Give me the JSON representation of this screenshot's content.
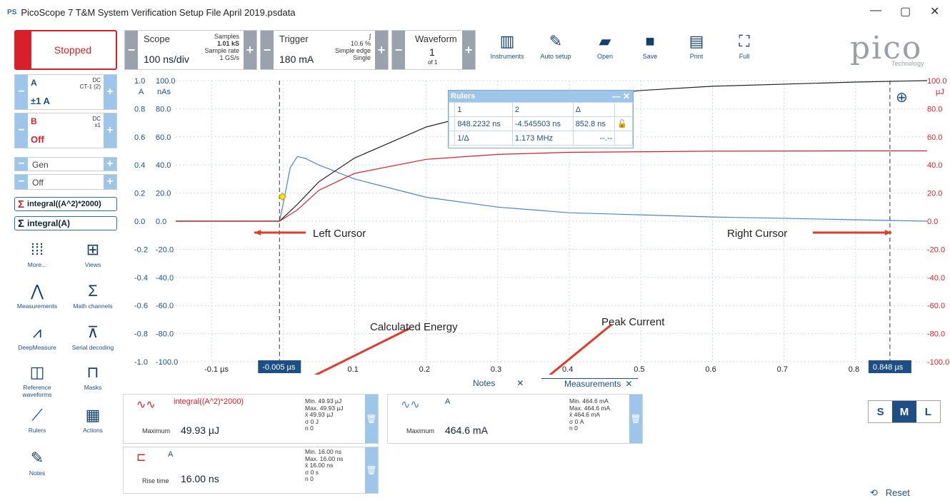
{
  "window": {
    "app_icon": "PS",
    "title": "PicoScope 7 T&M System Verification Setup File April 2019.psdata",
    "controls": [
      "—",
      "▢",
      "✕"
    ]
  },
  "toolbar": {
    "run_state": "Stopped",
    "scope": {
      "header": "Scope",
      "value": "100 ns/div",
      "samples_label": "Samples",
      "samples": "1.01 kS",
      "rate_label": "Sample rate",
      "rate": "1 GS/s"
    },
    "trigger": {
      "header": "Trigger",
      "value": "180 mA",
      "pct": "10.6 %",
      "type": "Simple edge",
      "mode": "Single"
    },
    "waveform": {
      "header": "Waveform",
      "value": "1",
      "of": "of 1"
    },
    "buttons": [
      {
        "label": "Instruments",
        "icon": "instruments-icon"
      },
      {
        "label": "Auto setup",
        "icon": "auto-setup-icon"
      },
      {
        "label": "Open",
        "icon": "folder-open-icon"
      },
      {
        "label": "Save",
        "icon": "save-icon"
      },
      {
        "label": "Print",
        "icon": "print-icon"
      },
      {
        "label": "Full",
        "icon": "fullscreen-icon"
      }
    ],
    "brand": "pico",
    "brand_sub": "Technology"
  },
  "channels": {
    "a": {
      "name": "A",
      "coupling": "DC",
      "probe": "CT-1 (2)",
      "range": "±1 A"
    },
    "b": {
      "name": "B",
      "coupling": "DC",
      "probe": "x1",
      "range": "Off"
    },
    "gen": {
      "name": "Gen",
      "state": "Off"
    },
    "math1": "integral((A^2)*2000)",
    "math2": "integral(A)"
  },
  "tools": [
    {
      "label": "More...",
      "icon": "more-dots-icon"
    },
    {
      "label": "Views",
      "icon": "views-grid-icon"
    },
    {
      "label": "Measurements",
      "icon": "measurements-icon"
    },
    {
      "label": "Math channels",
      "icon": "sigma-icon"
    },
    {
      "label": "DeepMeasure",
      "icon": "deepmeasure-icon"
    },
    {
      "label": "Serial decoding",
      "icon": "serial-decoding-icon"
    },
    {
      "label": "Reference waveforms",
      "icon": "reference-waveforms-icon"
    },
    {
      "label": "Masks",
      "icon": "masks-icon"
    },
    {
      "label": "Rulers",
      "icon": "ruler-icon"
    },
    {
      "label": "Actions",
      "icon": "clapperboard-icon"
    },
    {
      "label": "Notes",
      "icon": "notes-icon"
    }
  ],
  "chart_data": {
    "type": "line",
    "x_ticks": [
      "-0.1 µs",
      "0.1",
      "0.2",
      "0.3",
      "0.4",
      "0.5",
      "0.6",
      "0.7",
      "0.8"
    ],
    "left_axis_a": [
      "1.0",
      "0.8",
      "0.6",
      "0.4",
      "0.2",
      "0.0",
      "-0.2",
      "-0.4",
      "-0.6",
      "-0.8",
      "-1.0"
    ],
    "left_axis_nas": [
      "100.0",
      "80.0",
      "60.0",
      "40.0",
      "20.0",
      "0.0",
      "-20.0",
      "-40.0",
      "-60.0",
      "-80.0",
      "-100.0"
    ],
    "left_units": [
      "A",
      "nAs"
    ],
    "right_axis": [
      "100.0",
      "80.0",
      "60.0",
      "40.0",
      "20.0",
      "0.0",
      "-20.0",
      "-40.0",
      "-60.0",
      "-80.0",
      "-100.0"
    ],
    "right_unit": "µJ",
    "xlim": [
      -0.15,
      0.9
    ],
    "ylim": [
      -1.0,
      1.0
    ],
    "series": [
      {
        "color": "#4a86c8",
        "x": [
          -0.15,
          -0.005,
          0.0,
          0.01,
          0.02,
          0.03,
          0.05,
          0.1,
          0.2,
          0.3,
          0.4,
          0.6,
          0.8,
          0.9
        ],
        "y": [
          0.0,
          0.0,
          0.12,
          0.38,
          0.46,
          0.45,
          0.4,
          0.3,
          0.17,
          0.1,
          0.06,
          0.03,
          0.01,
          0.0
        ]
      },
      {
        "color": "#222222",
        "x": [
          -0.15,
          -0.005,
          0.02,
          0.05,
          0.1,
          0.2,
          0.3,
          0.4,
          0.5,
          0.6,
          0.8,
          0.9
        ],
        "y": [
          0.0,
          0.0,
          0.12,
          0.28,
          0.45,
          0.67,
          0.8,
          0.88,
          0.93,
          0.96,
          0.99,
          1.0
        ]
      },
      {
        "color": "#d8202a",
        "x": [
          -0.15,
          -0.005,
          0.02,
          0.05,
          0.1,
          0.2,
          0.3,
          0.4,
          0.6,
          0.8,
          0.9
        ],
        "y": [
          0.0,
          0.0,
          0.08,
          0.22,
          0.34,
          0.44,
          0.475,
          0.49,
          0.498,
          0.5,
          0.5
        ]
      }
    ],
    "cursors": {
      "left": "-0.005 µs",
      "right": "0.848 µs",
      "left_x": -0.005,
      "right_x": 0.848
    }
  },
  "annotations": {
    "left_cursor": "Left Cursor",
    "right_cursor": "Right Cursor",
    "energy": "Calculated Energy",
    "peak": "Peak Current"
  },
  "rulers": {
    "title": "Rulers",
    "h1": "1",
    "h2": "2",
    "hd": "Δ",
    "v1": "848.2232 ns",
    "v2": "-4.545503 ns",
    "vd": "852.8 ns",
    "inv_label": "1/Δ",
    "inv": "1.173 MHz",
    "inv2": "--.--"
  },
  "tabs": {
    "notes": "Notes",
    "measurements": "Measurements"
  },
  "measurements": [
    {
      "name": "integral((A^2)*2000)",
      "label": "Maximum",
      "value": "49.93 µJ",
      "min": "Min.  49.93 µJ",
      "max": "Max.  49.93 µJ",
      "mean": "x̄      49.93 µJ",
      "sd": "σ      0 J",
      "n": "n      0"
    },
    {
      "name": "A",
      "label": "Maximum",
      "value": "464.6 mA",
      "min": "Min.  464.6 mA",
      "max": "Max.  464.6 mA",
      "mean": "x̄      464.6 mA",
      "sd": "σ      0 A",
      "n": "n      0"
    },
    {
      "name": "A",
      "label": "Rise time",
      "value": "16.00 ns",
      "min": "Min.  16.00 ns",
      "max": "Max.  16.00 ns",
      "mean": "x̄      16.00 ns",
      "sd": "σ      0 s",
      "n": "n      0"
    }
  ],
  "size_toggle": {
    "s": "S",
    "m": "M",
    "l": "L"
  },
  "reset": "Reset"
}
